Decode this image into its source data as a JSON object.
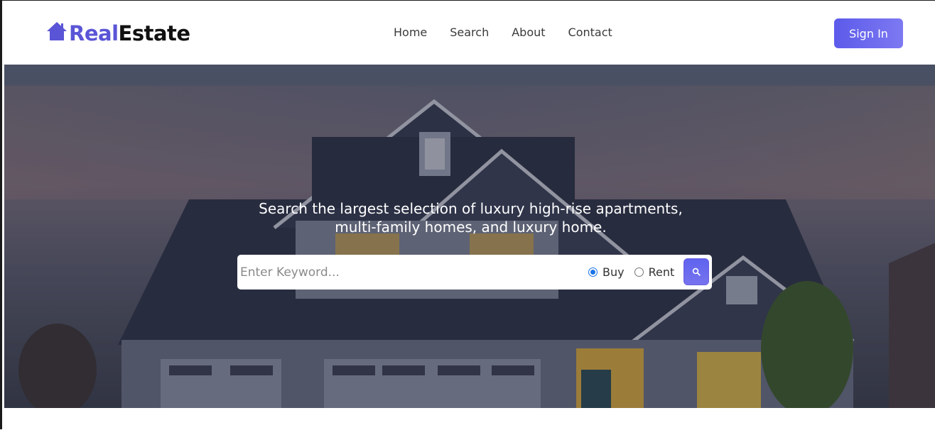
{
  "logo": {
    "part1": "Real",
    "part2": "Estate",
    "icon": "house-icon",
    "colors": {
      "accent": "#5a55d6",
      "dark": "#111111"
    }
  },
  "nav": {
    "items": [
      "Home",
      "Search",
      "About",
      "Contact"
    ]
  },
  "header": {
    "signin_label": "Sign In"
  },
  "hero": {
    "line1": "Search the largest selection of luxury high-rise apartments,",
    "line2": "multi-family homes, and luxury home."
  },
  "search": {
    "placeholder": "Enter Keyword...",
    "value": "",
    "options": [
      "Buy",
      "Rent"
    ],
    "selected": "Buy",
    "button_icon": "search-icon"
  },
  "colors": {
    "primary": "#5c5bea",
    "radio_checked": "#1a73e8"
  }
}
